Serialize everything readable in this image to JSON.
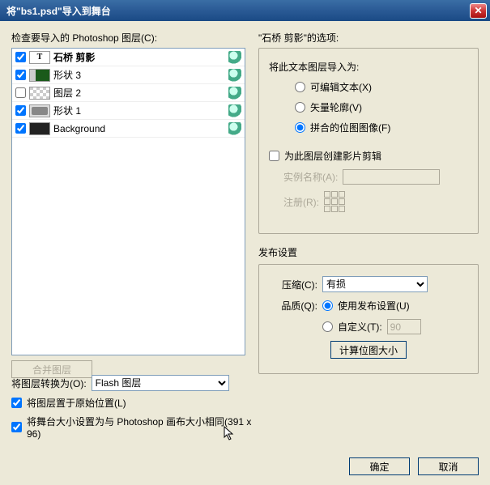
{
  "title": "将\"bs1.psd\"导入到舞台",
  "left": {
    "header": "检查要导入的 Photoshop 图层(C):",
    "layers": [
      {
        "name": "石桥 剪影",
        "checked": true,
        "thumb": "T",
        "sel": true
      },
      {
        "name": "形状 3",
        "checked": true,
        "thumb": "shape3"
      },
      {
        "name": "图层 2",
        "checked": false,
        "thumb": "layer2"
      },
      {
        "name": "形状 1",
        "checked": true,
        "thumb": "shape1"
      },
      {
        "name": "Background",
        "checked": true,
        "thumb": "bg"
      }
    ],
    "merge": "合并图层"
  },
  "right": {
    "options_for": "\"石桥 剪影\"的选项:",
    "import_as": "将此文本图层导入为:",
    "opt_editable": "可编辑文本(X)",
    "opt_vector": "矢量轮廓(V)",
    "opt_flat": "拼合的位图图像(F)",
    "create_clip": "为此图层创建影片剪辑",
    "instance_label": "实例名称(A):",
    "reg_label": "注册(R):",
    "publish_header": "发布设置",
    "compress_label": "压缩(C):",
    "compress_value": "有损",
    "quality_label": "品质(Q):",
    "quality_use": "使用发布设置(U)",
    "quality_custom": "自定义(T):",
    "quality_custom_val": "90",
    "calc": "计算位图大小"
  },
  "bottom": {
    "convert_label": "将图层转换为(O):",
    "convert_value": "Flash 图层",
    "place_orig": "将图层置于原始位置(L)",
    "stage_size": "将舞台大小设置为与 Photoshop 画布大小相同(391 x 96)"
  },
  "footer": {
    "ok": "确定",
    "cancel": "取消"
  }
}
